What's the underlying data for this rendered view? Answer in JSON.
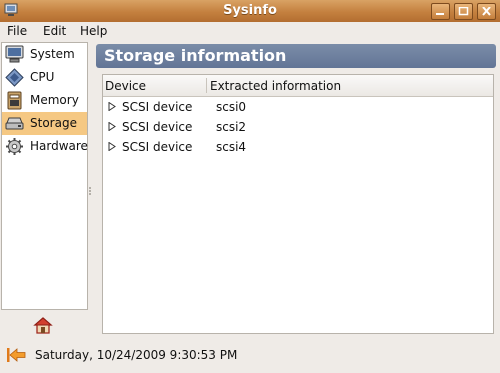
{
  "window": {
    "title": "Sysinfo"
  },
  "menu": {
    "items": [
      "File",
      "Edit",
      "Help"
    ]
  },
  "sidebar": {
    "items": [
      {
        "label": "System",
        "icon": "monitor-icon"
      },
      {
        "label": "CPU",
        "icon": "cpu-chip-icon"
      },
      {
        "label": "Memory",
        "icon": "memory-icon"
      },
      {
        "label": "Storage",
        "icon": "drive-icon",
        "selected": true
      },
      {
        "label": "Hardware",
        "icon": "gear-icon"
      }
    ]
  },
  "main": {
    "header": "Storage information",
    "table": {
      "columns": [
        "Device",
        "Extracted information"
      ],
      "rows": [
        {
          "device": "SCSI device",
          "info": "scsi0"
        },
        {
          "device": "SCSI device",
          "info": "scsi2"
        },
        {
          "device": "SCSI device",
          "info": "scsi4"
        }
      ]
    }
  },
  "status": {
    "text": "Saturday, 10/24/2009 9:30:53 PM"
  },
  "colors": {
    "titlebar": "#c4803f",
    "selection": "#f5c883",
    "header": "#6d80a0"
  }
}
